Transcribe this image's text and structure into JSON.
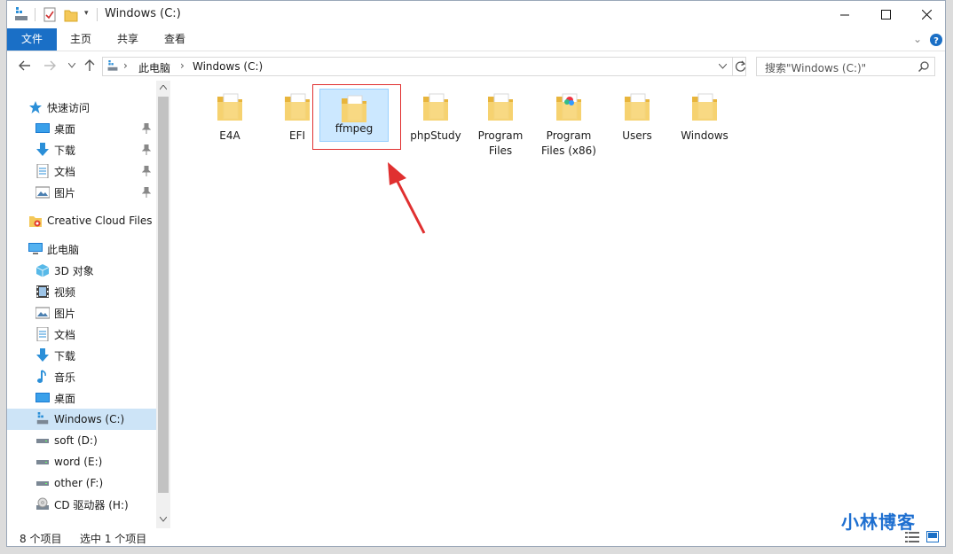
{
  "window": {
    "title": "Windows (C:)"
  },
  "ribbon": {
    "tabs": [
      "文件",
      "主页",
      "共享",
      "查看"
    ]
  },
  "address": {
    "segments": [
      "此电脑",
      "Windows (C:)"
    ]
  },
  "search": {
    "placeholder": "搜索\"Windows (C:)\""
  },
  "nav": {
    "quick_access": "快速访问",
    "quick_items": [
      "桌面",
      "下载",
      "文档",
      "图片"
    ],
    "creative_cloud": "Creative Cloud Files",
    "this_pc": "此电脑",
    "pc_items": [
      "3D 对象",
      "视频",
      "图片",
      "文档",
      "下载",
      "音乐",
      "桌面",
      "Windows (C:)",
      "soft (D:)",
      "word (E:)",
      "other (F:)",
      "CD 驱动器 (H:)"
    ],
    "selected": "Windows (C:)"
  },
  "folders": [
    {
      "line1": "E4A",
      "line2": ""
    },
    {
      "line1": "EFI",
      "line2": ""
    },
    {
      "line1": "ffmpeg",
      "line2": ""
    },
    {
      "line1": "phpStudy",
      "line2": ""
    },
    {
      "line1": "Program",
      "line2": "Files"
    },
    {
      "line1": "Program",
      "line2": "Files (x86)"
    },
    {
      "line1": "Users",
      "line2": ""
    },
    {
      "line1": "Windows",
      "line2": ""
    }
  ],
  "selected_folder": "ffmpeg",
  "status": {
    "item_count": "8 个项目",
    "selected_count": "选中 1 个项目"
  },
  "watermark": "小林博客",
  "colors": {
    "accent": "#1a6fc6",
    "selection": "#cce8ff",
    "highlight_box": "#e03030",
    "folder": "#f4c859"
  }
}
